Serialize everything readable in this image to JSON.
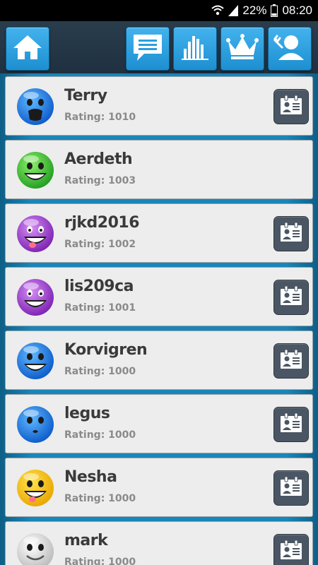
{
  "status_bar": {
    "battery": "22%",
    "time": "08:20",
    "icons": [
      "wifi-icon",
      "signal-icon",
      "battery-icon"
    ]
  },
  "toolbar": {
    "buttons": [
      {
        "icon": "home-icon"
      },
      {
        "icon": "chat-icon"
      },
      {
        "icon": "stats-icon"
      },
      {
        "icon": "crown-icon"
      },
      {
        "icon": "user-icon"
      }
    ]
  },
  "players": [
    {
      "name": "Terry",
      "rating": "Rating: 1010",
      "avatar": "scared-blue-face-icon",
      "has_profile_button": true
    },
    {
      "name": "Aerdeth",
      "rating": "Rating: 1003",
      "avatar": "grinning-green-face-icon",
      "has_profile_button": false
    },
    {
      "name": "rjkd2016",
      "rating": "Rating: 1002",
      "avatar": "silly-purple-face-icon",
      "has_profile_button": true
    },
    {
      "name": "lis209ca",
      "rating": "Rating: 1001",
      "avatar": "crazy-purple-face-icon",
      "has_profile_button": true
    },
    {
      "name": "Korvigren",
      "rating": "Rating: 1000",
      "avatar": "laughing-blue-face-icon",
      "has_profile_button": true
    },
    {
      "name": "legus",
      "rating": "Rating: 1000",
      "avatar": "kissing-blue-face-icon",
      "has_profile_button": true
    },
    {
      "name": "Nesha",
      "rating": "Rating: 1000",
      "avatar": "grinning-yellow-face-icon",
      "has_profile_button": true
    },
    {
      "name": "mark",
      "rating": "Rating: 1000",
      "avatar": "smiling-white-face-icon",
      "has_profile_button": true
    }
  ],
  "colors": {
    "toolbar_button": "#2a9fe0",
    "card_background": "#ededed",
    "list_background": "#1a86b8",
    "profile_button": "#4a5663"
  }
}
